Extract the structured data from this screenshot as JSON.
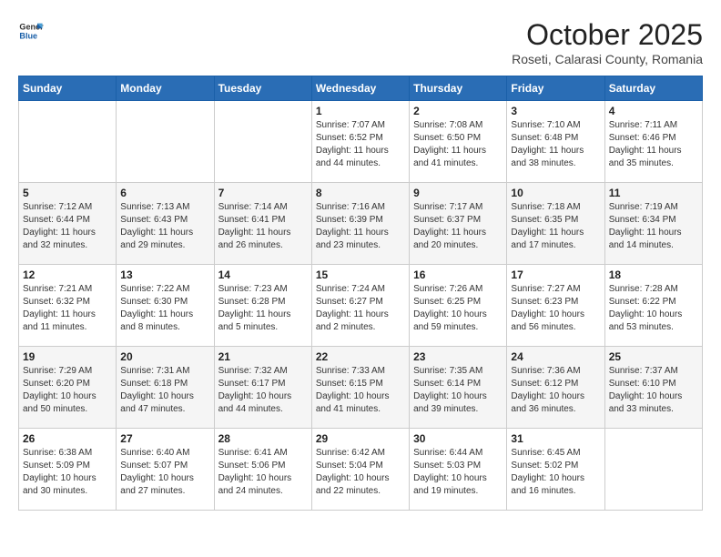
{
  "logo": {
    "general": "General",
    "blue": "Blue"
  },
  "title": "October 2025",
  "subtitle": "Roseti, Calarasi County, Romania",
  "days_of_week": [
    "Sunday",
    "Monday",
    "Tuesday",
    "Wednesday",
    "Thursday",
    "Friday",
    "Saturday"
  ],
  "weeks": [
    [
      {
        "day": "",
        "info": ""
      },
      {
        "day": "",
        "info": ""
      },
      {
        "day": "",
        "info": ""
      },
      {
        "day": "1",
        "info": "Sunrise: 7:07 AM\nSunset: 6:52 PM\nDaylight: 11 hours and 44 minutes."
      },
      {
        "day": "2",
        "info": "Sunrise: 7:08 AM\nSunset: 6:50 PM\nDaylight: 11 hours and 41 minutes."
      },
      {
        "day": "3",
        "info": "Sunrise: 7:10 AM\nSunset: 6:48 PM\nDaylight: 11 hours and 38 minutes."
      },
      {
        "day": "4",
        "info": "Sunrise: 7:11 AM\nSunset: 6:46 PM\nDaylight: 11 hours and 35 minutes."
      }
    ],
    [
      {
        "day": "5",
        "info": "Sunrise: 7:12 AM\nSunset: 6:44 PM\nDaylight: 11 hours and 32 minutes."
      },
      {
        "day": "6",
        "info": "Sunrise: 7:13 AM\nSunset: 6:43 PM\nDaylight: 11 hours and 29 minutes."
      },
      {
        "day": "7",
        "info": "Sunrise: 7:14 AM\nSunset: 6:41 PM\nDaylight: 11 hours and 26 minutes."
      },
      {
        "day": "8",
        "info": "Sunrise: 7:16 AM\nSunset: 6:39 PM\nDaylight: 11 hours and 23 minutes."
      },
      {
        "day": "9",
        "info": "Sunrise: 7:17 AM\nSunset: 6:37 PM\nDaylight: 11 hours and 20 minutes."
      },
      {
        "day": "10",
        "info": "Sunrise: 7:18 AM\nSunset: 6:35 PM\nDaylight: 11 hours and 17 minutes."
      },
      {
        "day": "11",
        "info": "Sunrise: 7:19 AM\nSunset: 6:34 PM\nDaylight: 11 hours and 14 minutes."
      }
    ],
    [
      {
        "day": "12",
        "info": "Sunrise: 7:21 AM\nSunset: 6:32 PM\nDaylight: 11 hours and 11 minutes."
      },
      {
        "day": "13",
        "info": "Sunrise: 7:22 AM\nSunset: 6:30 PM\nDaylight: 11 hours and 8 minutes."
      },
      {
        "day": "14",
        "info": "Sunrise: 7:23 AM\nSunset: 6:28 PM\nDaylight: 11 hours and 5 minutes."
      },
      {
        "day": "15",
        "info": "Sunrise: 7:24 AM\nSunset: 6:27 PM\nDaylight: 11 hours and 2 minutes."
      },
      {
        "day": "16",
        "info": "Sunrise: 7:26 AM\nSunset: 6:25 PM\nDaylight: 10 hours and 59 minutes."
      },
      {
        "day": "17",
        "info": "Sunrise: 7:27 AM\nSunset: 6:23 PM\nDaylight: 10 hours and 56 minutes."
      },
      {
        "day": "18",
        "info": "Sunrise: 7:28 AM\nSunset: 6:22 PM\nDaylight: 10 hours and 53 minutes."
      }
    ],
    [
      {
        "day": "19",
        "info": "Sunrise: 7:29 AM\nSunset: 6:20 PM\nDaylight: 10 hours and 50 minutes."
      },
      {
        "day": "20",
        "info": "Sunrise: 7:31 AM\nSunset: 6:18 PM\nDaylight: 10 hours and 47 minutes."
      },
      {
        "day": "21",
        "info": "Sunrise: 7:32 AM\nSunset: 6:17 PM\nDaylight: 10 hours and 44 minutes."
      },
      {
        "day": "22",
        "info": "Sunrise: 7:33 AM\nSunset: 6:15 PM\nDaylight: 10 hours and 41 minutes."
      },
      {
        "day": "23",
        "info": "Sunrise: 7:35 AM\nSunset: 6:14 PM\nDaylight: 10 hours and 39 minutes."
      },
      {
        "day": "24",
        "info": "Sunrise: 7:36 AM\nSunset: 6:12 PM\nDaylight: 10 hours and 36 minutes."
      },
      {
        "day": "25",
        "info": "Sunrise: 7:37 AM\nSunset: 6:10 PM\nDaylight: 10 hours and 33 minutes."
      }
    ],
    [
      {
        "day": "26",
        "info": "Sunrise: 6:38 AM\nSunset: 5:09 PM\nDaylight: 10 hours and 30 minutes."
      },
      {
        "day": "27",
        "info": "Sunrise: 6:40 AM\nSunset: 5:07 PM\nDaylight: 10 hours and 27 minutes."
      },
      {
        "day": "28",
        "info": "Sunrise: 6:41 AM\nSunset: 5:06 PM\nDaylight: 10 hours and 24 minutes."
      },
      {
        "day": "29",
        "info": "Sunrise: 6:42 AM\nSunset: 5:04 PM\nDaylight: 10 hours and 22 minutes."
      },
      {
        "day": "30",
        "info": "Sunrise: 6:44 AM\nSunset: 5:03 PM\nDaylight: 10 hours and 19 minutes."
      },
      {
        "day": "31",
        "info": "Sunrise: 6:45 AM\nSunset: 5:02 PM\nDaylight: 10 hours and 16 minutes."
      },
      {
        "day": "",
        "info": ""
      }
    ]
  ]
}
